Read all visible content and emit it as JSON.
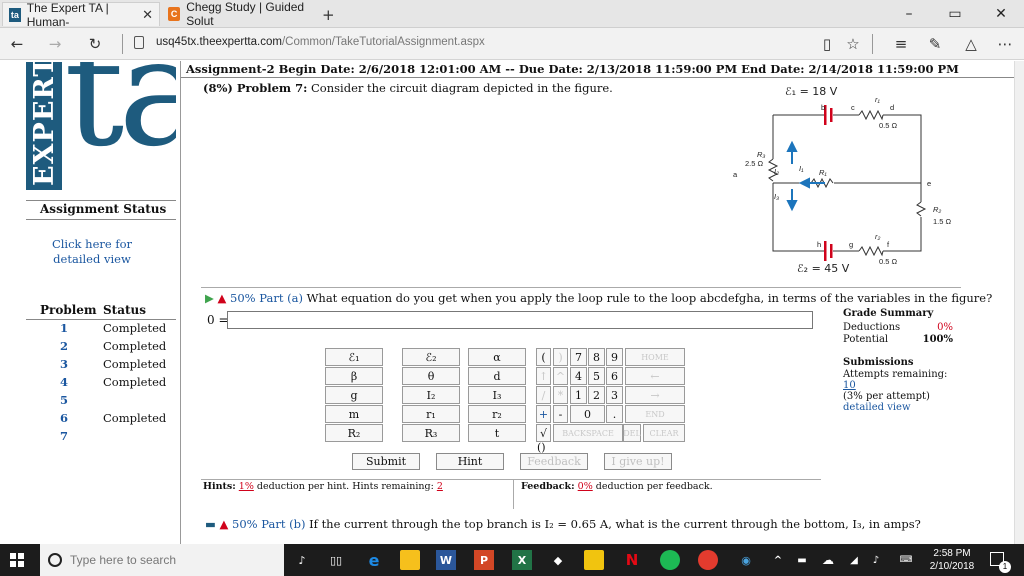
{
  "browser": {
    "tabs": [
      {
        "icon": "ta-favicon",
        "title": "The Expert TA | Human-",
        "active": true
      },
      {
        "icon": "chegg-favicon",
        "title": "Chegg Study | Guided Solut",
        "active": false
      }
    ],
    "url_host": "usq45tx.theexpertta.com",
    "url_path": "/Common/TakeTutorialAssignment.aspx"
  },
  "sidebar": {
    "logo_word": "EXPERT",
    "logo_ta": "ta",
    "status_heading": "Assignment Status",
    "detail_link": "Click here for detailed view",
    "col_problem": "Problem",
    "col_status": "Status",
    "problems": [
      {
        "num": "1",
        "status": "Completed"
      },
      {
        "num": "2",
        "status": "Completed"
      },
      {
        "num": "3",
        "status": "Completed"
      },
      {
        "num": "4",
        "status": "Completed"
      },
      {
        "num": "5",
        "status": ""
      },
      {
        "num": "6",
        "status": "Completed"
      },
      {
        "num": "7",
        "status": ""
      }
    ]
  },
  "assignment": {
    "header": "Assignment-2 Begin Date: 2/6/2018 12:01:00 AM -- Due Date: 2/13/2018 11:59:00 PM End Date: 2/14/2018 11:59:00 PM",
    "problem_prefix": "(8%) Problem 7:",
    "problem_text": "Consider the circuit diagram depicted in the figure."
  },
  "circuit": {
    "e1": "ℰ₁ = 18 V",
    "e2": "ℰ₂ = 45 V",
    "r1": "0.5 Ω",
    "r2": "0.5 Ω",
    "r3": "2.5 Ω",
    "rr": "1.5 Ω",
    "rlabel_top": "r₁",
    "rlabel_bot": "r₂",
    "R3": "R₃",
    "R1": "R₁",
    "R2": "R₂",
    "I1": "I₁",
    "I2": "I₂",
    "I3": "I₃",
    "nodes": [
      "a",
      "b",
      "c",
      "d",
      "e",
      "f",
      "g",
      "h"
    ]
  },
  "part_a": {
    "label": "50% Part (a)",
    "question": "What equation do you get when you apply the loop rule to the loop abcdefgha, in terms of the variables in the figure?",
    "answer_prefix": "0 =",
    "answer_value": ""
  },
  "keypad": {
    "vars": [
      [
        "ℰ₁",
        "ℰ₂",
        "α"
      ],
      [
        "β",
        "θ",
        "d"
      ],
      [
        "g",
        "I₂",
        "I₃"
      ],
      [
        "m",
        "r₁",
        "r₂"
      ],
      [
        "R₂",
        "R₃",
        "t"
      ]
    ],
    "ops": [
      "(",
      ")",
      "↑",
      "^",
      "/",
      "*",
      "+",
      "-",
      "√",
      "()"
    ],
    "digits": [
      "7",
      "8",
      "9",
      "4",
      "5",
      "6",
      "1",
      "2",
      "3",
      "0",
      "."
    ],
    "home": "HOME",
    "left": "←",
    "right": "→",
    "end": "END",
    "backspace": "BACKSPACE",
    "del": "DEL",
    "clear": "CLEAR"
  },
  "actions": {
    "submit": "Submit",
    "hint": "Hint",
    "feedback": "Feedback",
    "giveup": "I give up!"
  },
  "grade": {
    "title": "Grade Summary",
    "deductions_label": "Deductions",
    "deductions_value": "0%",
    "potential_label": "Potential",
    "potential_value": "100%",
    "submissions_label": "Submissions",
    "attempts_label": "Attempts remaining:",
    "attempts_value": "10",
    "per_attempt": "(3% per attempt)",
    "detailed": "detailed view"
  },
  "hints": {
    "label": "Hints:",
    "deduction": "1%",
    "text": "deduction per hint. Hints remaining:",
    "remaining": "2"
  },
  "feedback": {
    "label": "Feedback:",
    "deduction": "0%",
    "text": "deduction per feedback."
  },
  "part_b": {
    "label": "50% Part (b)",
    "question": "If the current through the top branch is I₂ = 0.65 A, what is the current through the bottom, I₃, in amps?",
    "current_value": "0.65"
  },
  "taskbar": {
    "search_placeholder": "Type here to search",
    "time": "2:58 PM",
    "date": "2/10/2018",
    "notification_count": "1"
  },
  "colors": {
    "logo_blue": "#1e5b7e",
    "link_blue": "#1b57a0",
    "warning_red": "#d0021b",
    "taskbar": "#1c1c1c"
  }
}
